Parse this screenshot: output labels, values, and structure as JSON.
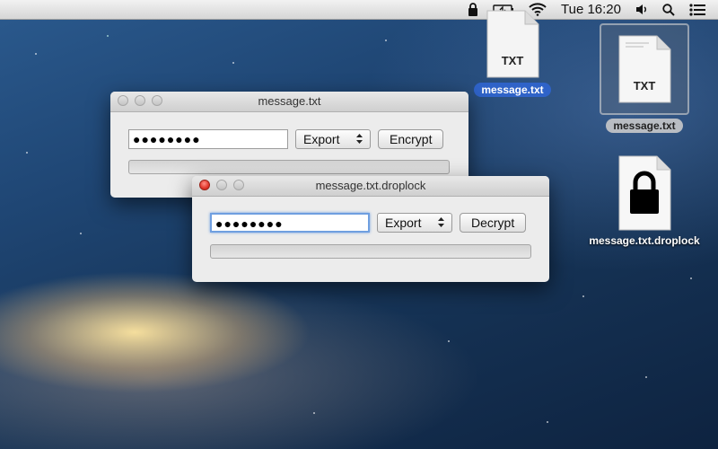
{
  "menubar": {
    "clock": "Tue 16:20",
    "icons": [
      "lock-icon",
      "battery-icon",
      "wifi-icon",
      "volume-icon",
      "spotlight-search-icon",
      "notification-center-icon"
    ]
  },
  "desktop": {
    "icons": [
      {
        "name": "message.txt",
        "type": "TXT",
        "state": "selected-blue",
        "kind": "document"
      },
      {
        "name": "message.txt",
        "type": "TXT",
        "state": "selected-grey",
        "kind": "document"
      },
      {
        "name": "message.txt.droplock",
        "type": "",
        "state": "normal",
        "kind": "lock"
      }
    ]
  },
  "windows": {
    "encrypt": {
      "title": "message.txt",
      "password": "●●●●●●●●",
      "export_label": "Export",
      "action_label": "Encrypt",
      "progress": 0
    },
    "decrypt": {
      "title": "message.txt.droplock",
      "password": "●●●●●●●●",
      "export_label": "Export",
      "action_label": "Decrypt",
      "progress": 0
    }
  },
  "colors": {
    "accent": "#2f63c8",
    "focus_ring": "#6f9fe0",
    "close_red": "#e0352a"
  }
}
